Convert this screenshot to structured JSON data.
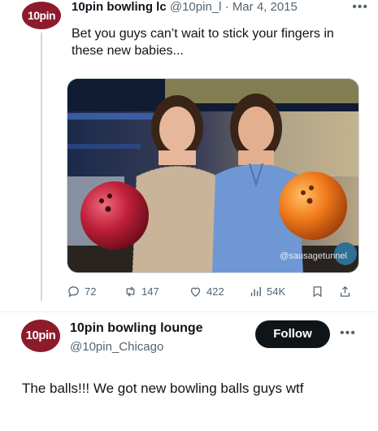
{
  "quoted_tweet": {
    "avatar_text": "10pin",
    "display_name": "10pin bowling lc",
    "handle": "@10pin_l",
    "separator": "·",
    "date": "Mar 4, 2015",
    "text": "Bet you guys can’t wait to stick your fingers in these new babies...",
    "image": {
      "watermark": "@sausagetunnel"
    },
    "actions": {
      "replies": "72",
      "retweets": "147",
      "likes": "422",
      "views": "54K"
    }
  },
  "main_tweet": {
    "avatar_text": "10pin",
    "display_name": "10pin bowling lounge",
    "handle": "@10pin_Chicago",
    "follow_label": "Follow",
    "text": "The balls!!! We got new bowling balls guys wtf"
  },
  "icons": {
    "reply": "reply-icon",
    "retweet": "retweet-icon",
    "like": "heart-icon",
    "views": "views-icon",
    "bookmark": "bookmark-icon",
    "share": "share-icon",
    "more": "more-icon"
  },
  "colors": {
    "brand_avatar": "#8c1b2c",
    "follow_button": "#0f1419",
    "secondary_text": "#536471",
    "ball_red": "#c0203a",
    "ball_orange": "#f07a1a"
  }
}
